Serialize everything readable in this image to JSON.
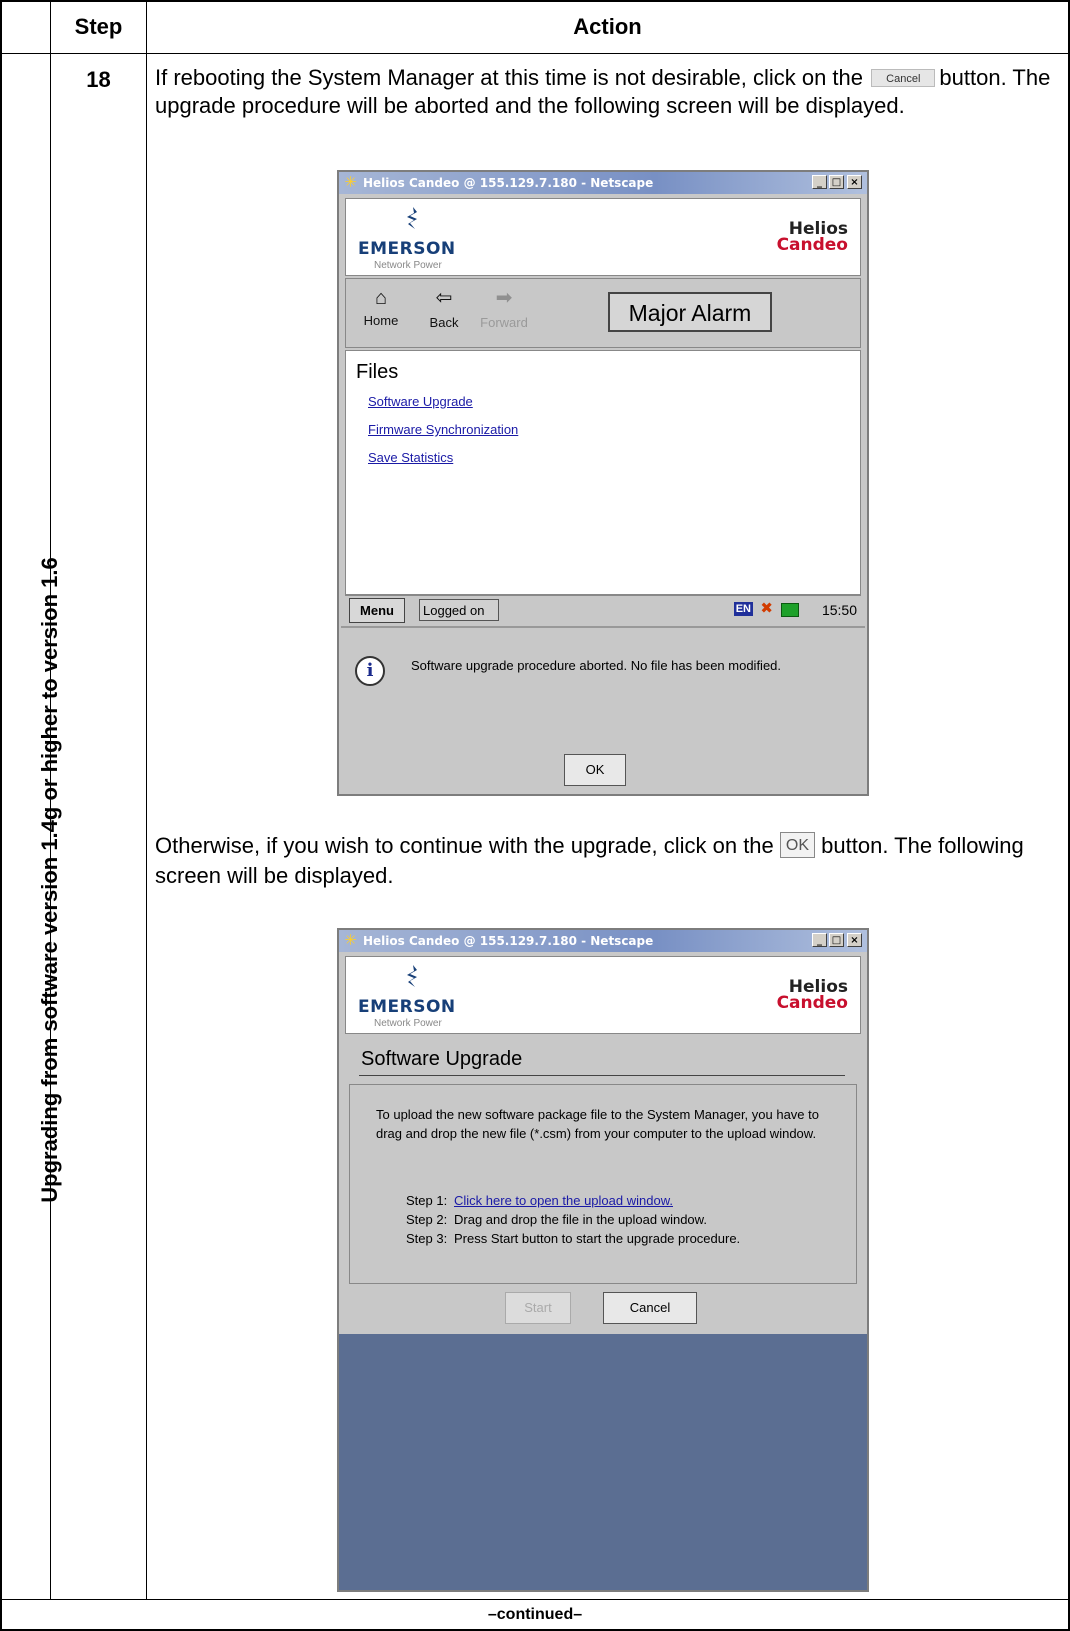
{
  "table": {
    "header_step": "Step",
    "header_action": "Action",
    "side_label": "Upgrading from software version 1.4g or higher to version 1.6",
    "step_number": "18",
    "footer": "–continued–"
  },
  "paragraph1": {
    "part1": "If rebooting the System Manager at this time is not desirable, click on the",
    "button_label": "Cancel",
    "part2": "button. The upgrade procedure will be aborted and the following screen will be displayed."
  },
  "paragraph2": {
    "part1": "Otherwise, if you wish to continue with the upgrade, click on the",
    "button_label": "OK",
    "part2": "button. The following screen will be displayed."
  },
  "window1": {
    "title": "Helios Candeo @ 155.129.7.180 - Netscape",
    "logo_main": "EMERSON",
    "logo_sub": "Network Power",
    "brand_line1": "Helios",
    "brand_line2": "Candeo",
    "nav": {
      "home": "Home",
      "back": "Back",
      "forward": "Forward"
    },
    "alarm": "Major Alarm",
    "section_title": "Files",
    "links": [
      "Software Upgrade",
      "Firmware Synchronization",
      "Save Statistics"
    ],
    "status": {
      "menu": "Menu",
      "logged": "Logged on",
      "lang": "EN",
      "time": "15:50"
    },
    "message": "Software upgrade procedure aborted. No file has been modified.",
    "ok_label": "OK"
  },
  "window2": {
    "title": "Helios Candeo @ 155.129.7.180 - Netscape",
    "logo_main": "EMERSON",
    "logo_sub": "Network Power",
    "brand_line1": "Helios",
    "brand_line2": "Candeo",
    "heading": "Software Upgrade",
    "intro": "To upload the new software package file to the System Manager, you have to drag and drop the new file (*.csm) from your computer to the upload window.",
    "steps": [
      {
        "label": "Step 1:",
        "text": "Click here to open the upload window."
      },
      {
        "label": "Step 2:",
        "text": "Drag and drop the file in the upload window."
      },
      {
        "label": "Step 3:",
        "text": "Press Start button to start the upgrade procedure."
      }
    ],
    "start_label": "Start",
    "cancel_label": "Cancel"
  },
  "colors": {
    "link": "#1a1aa6",
    "brand_red": "#c8102e",
    "emerson_blue": "#173f78",
    "footer_panel": "#5b6e92"
  }
}
